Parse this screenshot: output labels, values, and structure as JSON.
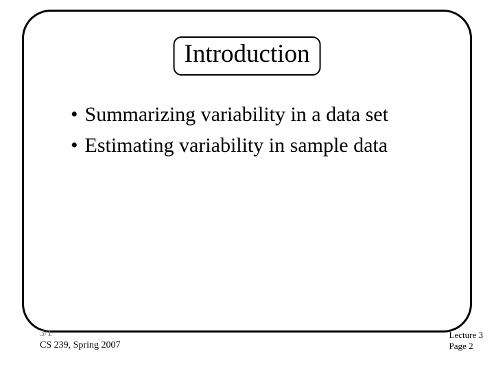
{
  "title": "Introduction",
  "bullets": [
    "Summarizing variability in a data set",
    "Estimating variability in sample data"
  ],
  "footer": {
    "date": "3/1",
    "course": "CS 239, Spring 2007",
    "lecture": "Lecture 3",
    "page": "Page 2"
  }
}
